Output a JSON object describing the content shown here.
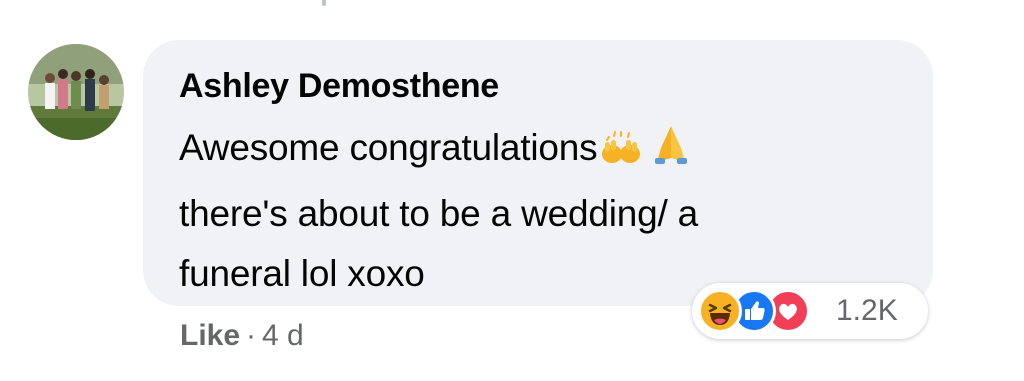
{
  "comment": {
    "author": "Ashley Demosthene",
    "text_lines": [
      "Awesome congratulations",
      "there's about to be a wedding/ a",
      "funeral lol xoxo"
    ],
    "inline_emojis": [
      "raising-hands-icon",
      "folded-hands-icon"
    ]
  },
  "actions": {
    "like_label": "Like",
    "separator": "·",
    "timestamp": "4 d"
  },
  "reactions": {
    "icons": [
      "haha-icon",
      "like-icon",
      "love-icon"
    ],
    "count": "1.2K"
  },
  "colors": {
    "bubble_bg": "#f0f2f5",
    "secondary_text": "#65676b",
    "like_blue": "#1877f2",
    "love_red": "#f33e58",
    "haha_yellow": "#f7b125"
  }
}
